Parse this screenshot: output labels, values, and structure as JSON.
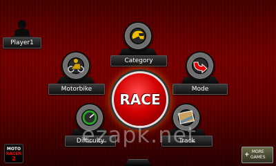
{
  "player": {
    "name": "Player1"
  },
  "menu": {
    "category_label": "Category",
    "motorbike_label": "Motorbike",
    "mode_label": "Mode",
    "difficulty_label": "Difficulty",
    "track_label": "Track",
    "race_label": "RACE"
  },
  "logo": {
    "line1": "MOTO",
    "line2": "RACER",
    "line3": "2"
  },
  "more_games": {
    "line1": "MORE",
    "line2": "GAMES"
  },
  "watermark": "ezapk.net",
  "colors": {
    "race_button": "#d40000",
    "background": "#6a0000",
    "label_text": "#ffffff"
  },
  "icons": {
    "player": "rider-silhouette-icon",
    "category": "helmet-icon",
    "motorbike": "motorbike-icon",
    "mode": "mode-arrow-icon",
    "difficulty": "gauge-icon",
    "track": "track-photo-icon",
    "more_games": "plus-icon"
  }
}
